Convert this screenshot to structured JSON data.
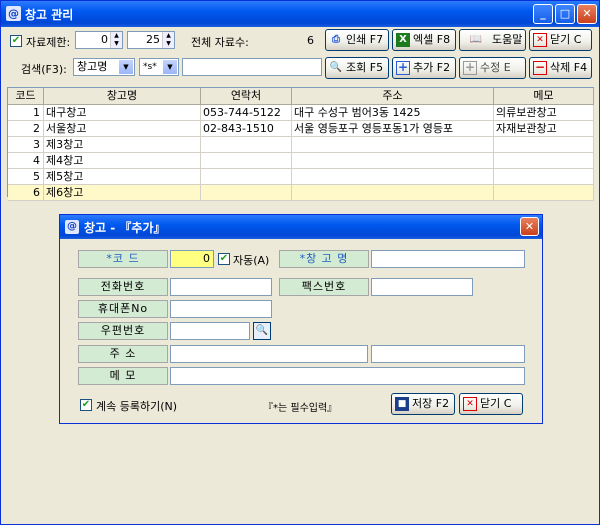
{
  "window": {
    "title": "창고 관리",
    "icon": "@"
  },
  "toolbar1": {
    "limit_label": "자료제한:",
    "limit_from": "0",
    "limit_to": "25",
    "total_label": "전체 자료수:",
    "total_value": "6",
    "print_label": "인쇄 F7",
    "excel_label": "엑셀 F8",
    "help_label": "도움말",
    "close_label": "닫기 C"
  },
  "toolbar2": {
    "search_label": "검색(F3):",
    "field_select": "창고명",
    "mode_select": "*s*",
    "search_value": "",
    "query_label": "조회 F5",
    "add_label": "추가 F2",
    "edit_label": "수정 E",
    "delete_label": "삭제 F4"
  },
  "grid": {
    "headers": [
      "코드",
      "창고명",
      "연락처",
      "주소",
      "메모"
    ],
    "rows": [
      [
        "1",
        "대구창고",
        "053-744-5122",
        "대구 수성구 범어3동 1425",
        "의류보관창고"
      ],
      [
        "2",
        "서울창고",
        "02-843-1510",
        "서울 영등포구 영등포동1가 영등포",
        "자재보관창고"
      ],
      [
        "3",
        "제3창고",
        "",
        "",
        ""
      ],
      [
        "4",
        "제4창고",
        "",
        "",
        ""
      ],
      [
        "5",
        "제5창고",
        "",
        "",
        ""
      ],
      [
        "6",
        "제6창고",
        "",
        "",
        ""
      ]
    ]
  },
  "dialog": {
    "title": "창고 - 『추가』",
    "code_label": "*코    드",
    "code_value": "0",
    "auto_label": "자동(A)",
    "name_label": "*창 고 명",
    "phone_label": "전화번호",
    "fax_label": "팩스번호",
    "mobile_label": "휴대폰No",
    "zip_label": "우편번호",
    "addr_label": "주    소",
    "memo_label": "메    모",
    "continue_label": "계속 등록하기(N)",
    "required_note": "『*는 필수입력』",
    "save_label": "저장 F2",
    "close_label": "닫기 C"
  },
  "colors": {
    "accent": "#0058EE",
    "selected_row": "#FFF8C8",
    "label_bg": "#D3EAD3",
    "code_field": "#FFFF80"
  }
}
